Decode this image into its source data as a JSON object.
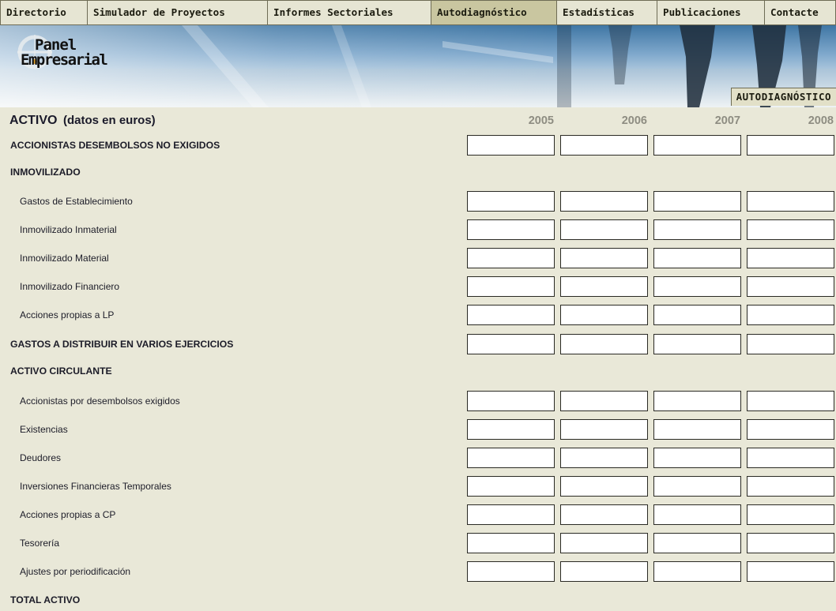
{
  "nav": {
    "items": [
      {
        "label": "Directorio"
      },
      {
        "label": "Simulador de Proyectos"
      },
      {
        "label": "Informes Sectoriales"
      },
      {
        "label": "Autodiagnóstico"
      },
      {
        "label": "Estadísticas"
      },
      {
        "label": "Publicaciones"
      },
      {
        "label": "Contacte"
      }
    ],
    "active_index": 3
  },
  "banner": {
    "logo_line1": "Panel",
    "logo_line2": "Empresarial",
    "section_tag": "AUTODIAGNÓSTICO"
  },
  "form": {
    "title": "ACTIVO",
    "subtitle": "(datos en euros)",
    "years": [
      "2005",
      "2006",
      "2007",
      "2008"
    ],
    "rows": [
      {
        "label": "ACCIONISTAS DESEMBOLSOS NO EXIGIDOS",
        "kind": "section",
        "inputs": true,
        "values": [
          "",
          "",
          "",
          ""
        ]
      },
      {
        "label": "INMOVILIZADO",
        "kind": "section",
        "inputs": false
      },
      {
        "label": "Gastos de Establecimiento",
        "kind": "sub",
        "inputs": true,
        "values": [
          "",
          "",
          "",
          ""
        ]
      },
      {
        "label": "Inmovilizado Inmaterial",
        "kind": "sub",
        "inputs": true,
        "values": [
          "",
          "",
          "",
          ""
        ]
      },
      {
        "label": "Inmovilizado Material",
        "kind": "sub",
        "inputs": true,
        "values": [
          "",
          "",
          "",
          ""
        ]
      },
      {
        "label": "Inmovilizado Financiero",
        "kind": "sub",
        "inputs": true,
        "values": [
          "",
          "",
          "",
          ""
        ]
      },
      {
        "label": "Acciones propias a LP",
        "kind": "sub",
        "inputs": true,
        "values": [
          "",
          "",
          "",
          ""
        ]
      },
      {
        "label": "GASTOS A DISTRIBUIR EN VARIOS EJERCICIOS",
        "kind": "section",
        "inputs": true,
        "values": [
          "",
          "",
          "",
          ""
        ]
      },
      {
        "label": "ACTIVO CIRCULANTE",
        "kind": "section",
        "inputs": false
      },
      {
        "label": "Accionistas por desembolsos exigidos",
        "kind": "sub",
        "inputs": true,
        "values": [
          "",
          "",
          "",
          ""
        ]
      },
      {
        "label": "Existencias",
        "kind": "sub",
        "inputs": true,
        "values": [
          "",
          "",
          "",
          ""
        ]
      },
      {
        "label": "Deudores",
        "kind": "sub",
        "inputs": true,
        "values": [
          "",
          "",
          "",
          ""
        ]
      },
      {
        "label": "Inversiones Financieras Temporales",
        "kind": "sub",
        "inputs": true,
        "values": [
          "",
          "",
          "",
          ""
        ]
      },
      {
        "label": "Acciones propias a CP",
        "kind": "sub",
        "inputs": true,
        "values": [
          "",
          "",
          "",
          ""
        ]
      },
      {
        "label": "Tesorería",
        "kind": "sub",
        "inputs": true,
        "values": [
          "",
          "",
          "",
          ""
        ]
      },
      {
        "label": "Ajustes por periodificación",
        "kind": "sub",
        "inputs": true,
        "values": [
          "",
          "",
          "",
          ""
        ]
      },
      {
        "label": "TOTAL ACTIVO",
        "kind": "section",
        "inputs": false
      }
    ]
  },
  "colors": {
    "page_background": "#e9e8d8",
    "nav_background": "#e6e5d3",
    "nav_active": "#c9c6a0",
    "year_text": "#8e8d82"
  }
}
